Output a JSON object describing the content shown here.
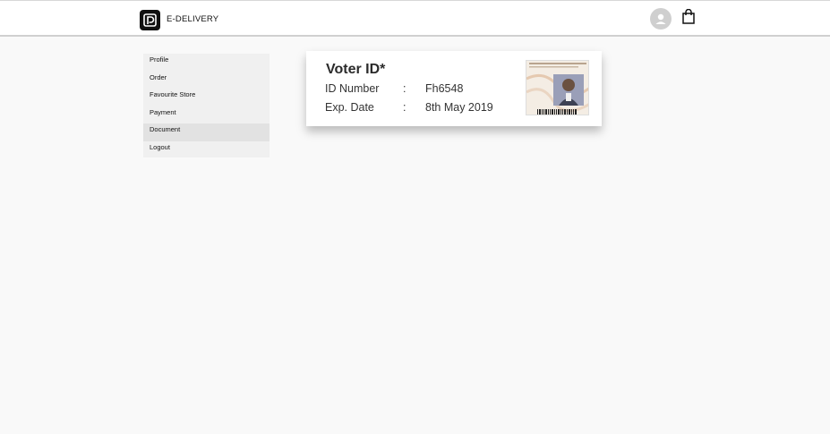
{
  "header": {
    "brand": "E-DELIVERY",
    "logo_icon": "delivery-logo-icon",
    "avatar_icon": "user-avatar-icon",
    "bag_icon": "shopping-bag-icon"
  },
  "sidebar": {
    "items": [
      {
        "label": "Profile"
      },
      {
        "label": "Order"
      },
      {
        "label": "Favourite Store"
      },
      {
        "label": "Payment"
      },
      {
        "label": "Document",
        "active": true
      },
      {
        "label": "Logout"
      }
    ]
  },
  "document_card": {
    "title": "Voter ID*",
    "rows": [
      {
        "label": "ID Number",
        "separator": ":",
        "value": "Fh6548"
      },
      {
        "label": "Exp. Date",
        "separator": ":",
        "value": "8th May 2019"
      }
    ],
    "image_icon": "voter-id-card-image"
  },
  "colors": {
    "background": "#f9f9f9",
    "active_item": "#e2e2e2",
    "sidebar": "#f0f0f0"
  }
}
